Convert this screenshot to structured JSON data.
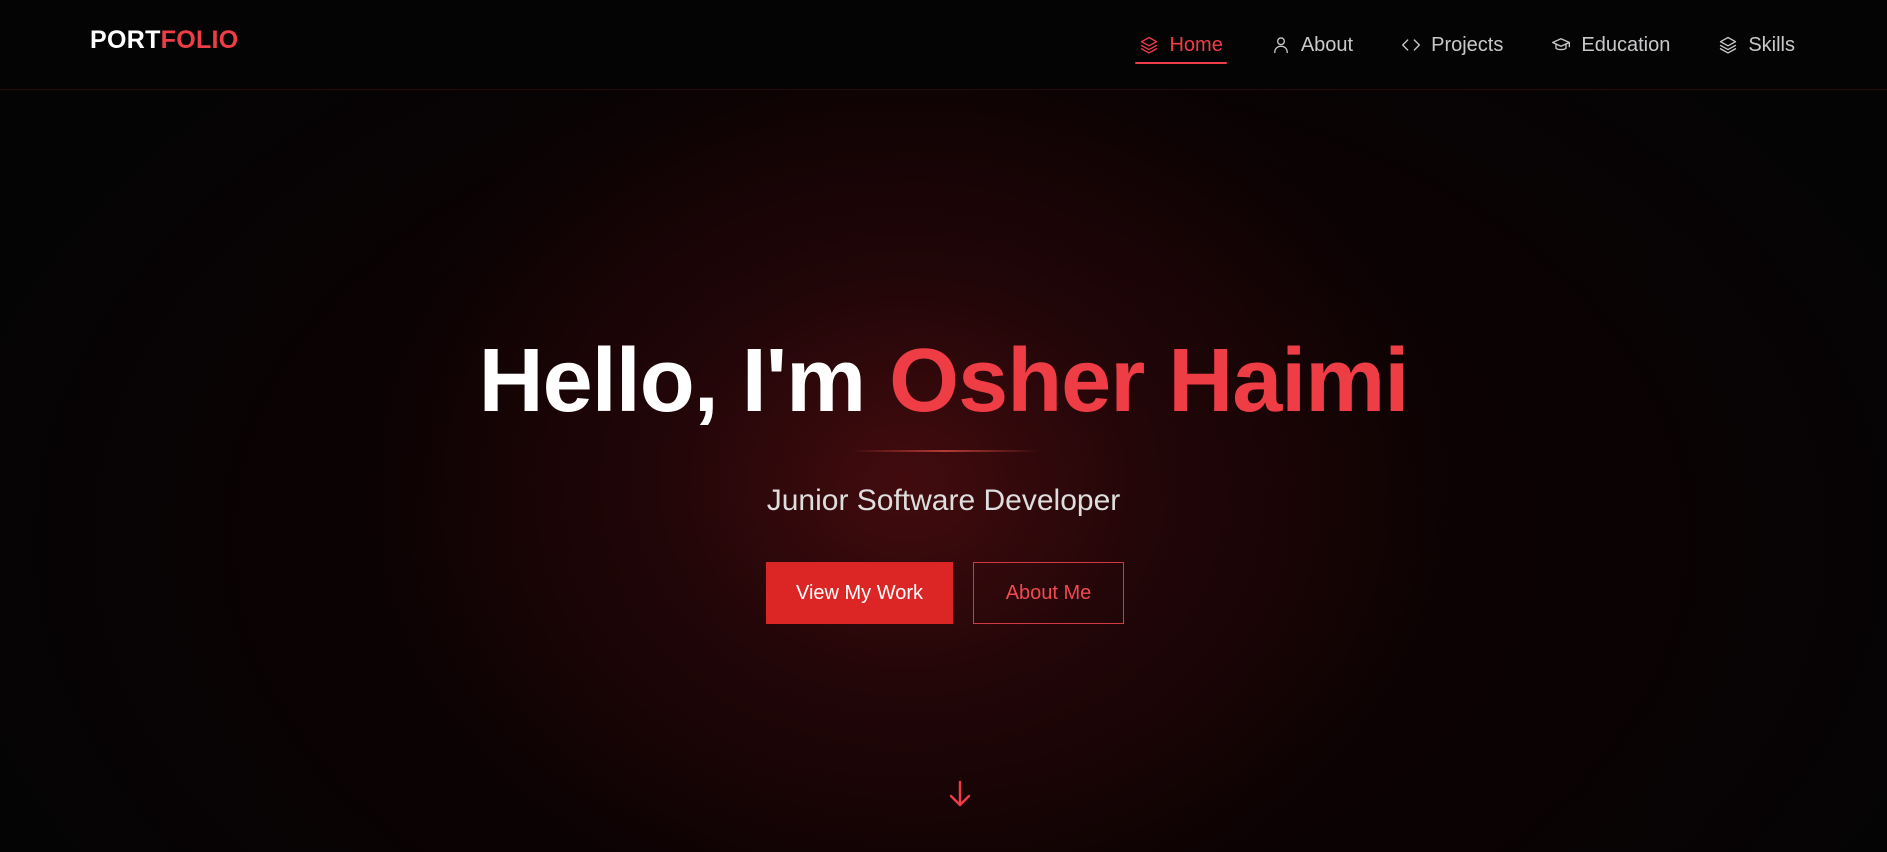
{
  "brand": {
    "part1": "PORT",
    "part2": "FOLIO"
  },
  "nav": {
    "items": [
      {
        "label": "Home",
        "icon": "layers-icon",
        "active": true
      },
      {
        "label": "About",
        "icon": "user-icon",
        "active": false
      },
      {
        "label": "Projects",
        "icon": "code-icon",
        "active": false
      },
      {
        "label": "Education",
        "icon": "graduation-cap-icon",
        "active": false
      },
      {
        "label": "Skills",
        "icon": "layers-icon",
        "active": false
      }
    ]
  },
  "hero": {
    "greeting": "Hello, I'm ",
    "name": "Osher Haimi",
    "subtitle": "Junior Software Developer",
    "primary_button": "View My Work",
    "secondary_button": "About Me",
    "scroll_icon": "arrow-down-icon"
  },
  "colors": {
    "accent": "#ef3d46",
    "button_red": "#dc2626",
    "background": "#050505",
    "nav_text": "#c9c9cc"
  }
}
